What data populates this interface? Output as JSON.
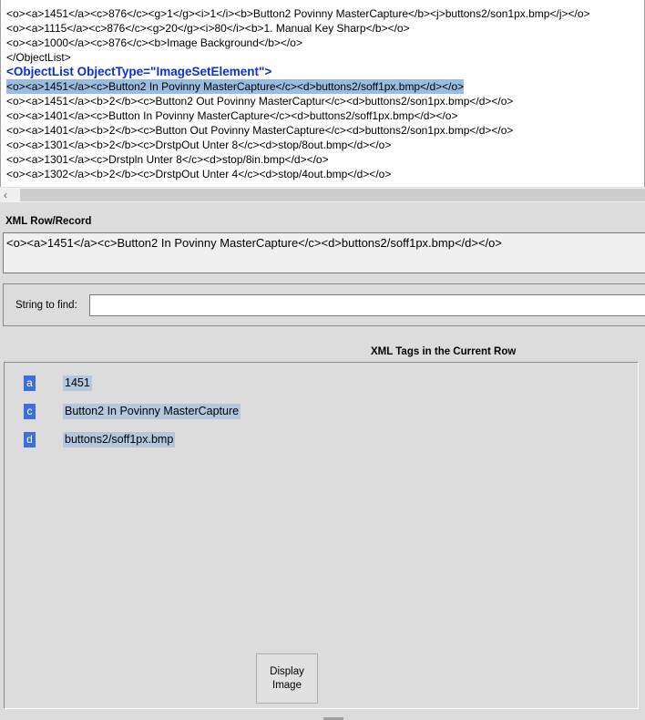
{
  "xml_lines": [
    {
      "text": "<o><a>1451</a><c>876</c><g>1</g><i>1</i><b>Button2 Povinny MasterCapture</b><j>buttons2/son1px.bmp</j></o>",
      "style": ""
    },
    {
      "text": "<o><a>1115</a><c>876</c><g>20</g><i>80</i><b>1. Manual Key Sharp</b></o>",
      "style": ""
    },
    {
      "text": "<o><a>1000</a><c>876</c><b>Image Background</b></o>",
      "style": ""
    },
    {
      "text": "</ObjectList>",
      "style": ""
    },
    {
      "text": "<ObjectList ObjectType=\"ImageSetElement\">",
      "style": "hdr"
    },
    {
      "text": "<o><a>1451</a><c>Button2 In Povinny MasterCapture</c><d>buttons2/soff1px.bmp</d></o>",
      "style": "sel"
    },
    {
      "text": "<o><a>1451</a><b>2</b><c>Button2 Out Povinny MasterCaptur</c><d>buttons2/son1px.bmp</d></o>",
      "style": ""
    },
    {
      "text": "<o><a>1401</a><c>Button In Povinny MasterCapture</c><d>buttons2/soff1px.bmp</d></o>",
      "style": ""
    },
    {
      "text": "<o><a>1401</a><b>2</b><c>Button Out Povinny MasterCapture</c><d>buttons2/son1px.bmp</d></o>",
      "style": ""
    },
    {
      "text": "<o><a>1301</a><b>2</b><c>DrstpOut Unter 8</c><d>stop/8out.bmp</d></o>",
      "style": ""
    },
    {
      "text": "<o><a>1301</a><c>Drstpln Unter 8</c><d>stop/8in.bmp</d></o>",
      "style": ""
    },
    {
      "text": "<o><a>1302</a><b>2</b><c>DrstpOut Unter 4</c><d>stop/4out.bmp</d></o>",
      "style": ""
    }
  ],
  "row_record": {
    "label": "XML Row/Record",
    "value": "<o><a>1451</a><c>Button2 In Povinny MasterCapture</c><d>buttons2/soff1px.bmp</d></o>"
  },
  "find": {
    "label": "String to find:",
    "value": ""
  },
  "tags_panel": {
    "title": "XML Tags in the Current Row",
    "tags": [
      {
        "name": "a",
        "value": "1451"
      },
      {
        "name": "c",
        "value": "Button2 In Povinny MasterCapture"
      },
      {
        "name": "d",
        "value": "buttons2/soff1px.bmp"
      }
    ]
  },
  "display_button": "Display\nImage",
  "scroll_left_icon": "‹"
}
